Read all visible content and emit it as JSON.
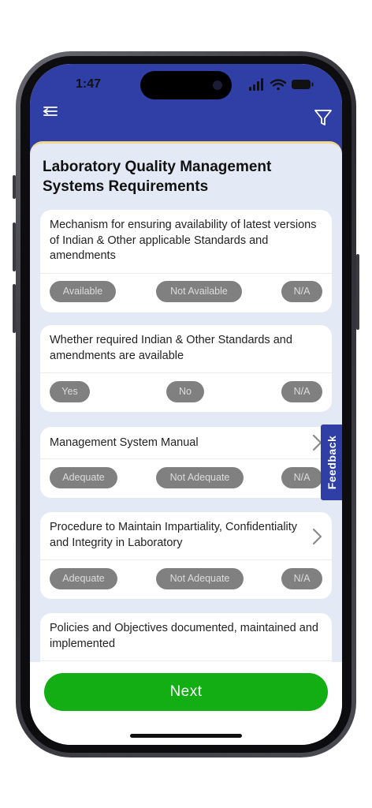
{
  "status_bar": {
    "time": "1:47"
  },
  "page": {
    "title": "Laboratory Quality Management Systems Requirements"
  },
  "questions": [
    {
      "text": "Mechanism for ensuring availability of latest versions of Indian & Other applicable Standards and amendments",
      "options": [
        "Available",
        "Not Available",
        "N/A"
      ]
    },
    {
      "text": "Whether required Indian & Other Standards and amendments are available",
      "options": [
        "Yes",
        "No",
        "N/A"
      ]
    },
    {
      "text": "Management System Manual",
      "options": [
        "Adequate",
        "Not Adequate",
        "N/A"
      ]
    },
    {
      "text": "Procedure to Maintain Impartiality, Confidentiality and Integrity in Laboratory",
      "options": [
        "Adequate",
        "Not Adequate",
        "N/A"
      ]
    },
    {
      "text": "Policies and Objectives documented, maintained and implemented"
    }
  ],
  "feedback": {
    "label": "Feedback"
  },
  "footer": {
    "next_label": "Next"
  },
  "colors": {
    "header": "#2f3fa6",
    "content_bg": "#e4eaf5",
    "next_button": "#13ad14",
    "pill": "#808080"
  }
}
